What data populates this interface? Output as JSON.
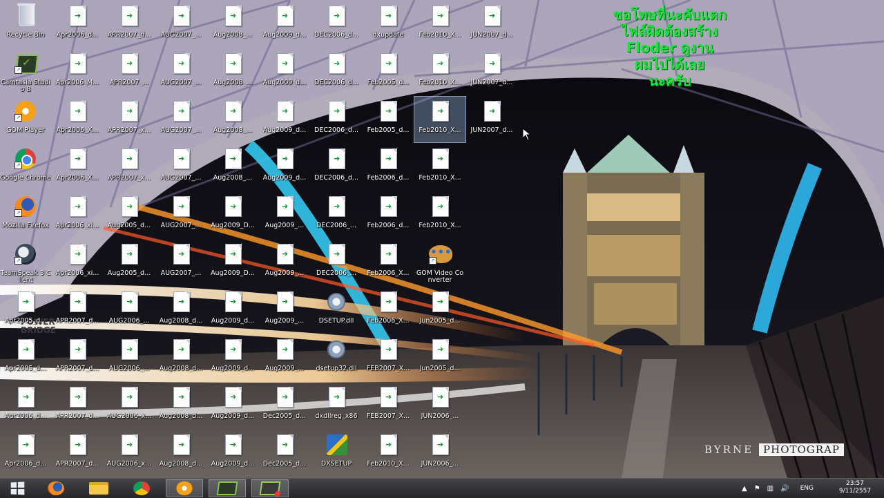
{
  "desktop": {
    "columns": [
      [
        {
          "label": "Recycle Bin",
          "kind": "recycle"
        },
        {
          "label": "Camtasia Studio 8",
          "kind": "camtasia",
          "shortcut": true
        },
        {
          "label": "GOM Player",
          "kind": "gom",
          "shortcut": true
        },
        {
          "label": "Google Chrome",
          "kind": "chrome",
          "shortcut": true
        },
        {
          "label": "Mozilla Firefox",
          "kind": "firefox",
          "shortcut": true
        },
        {
          "label": "TeamSpeak 3 Client",
          "kind": "teamspeak",
          "shortcut": true
        },
        {
          "label": "Apr2005_d...",
          "kind": "doc"
        },
        {
          "label": "Apr2005_d...",
          "kind": "doc"
        },
        {
          "label": "Apr2006_d...",
          "kind": "doc"
        },
        {
          "label": "Apr2006_d...",
          "kind": "doc"
        }
      ],
      [
        {
          "label": "Apr2006_d...",
          "kind": "doc"
        },
        {
          "label": "Apr2006_M...",
          "kind": "doc"
        },
        {
          "label": "Apr2006_X...",
          "kind": "doc"
        },
        {
          "label": "Apr2006_X...",
          "kind": "doc"
        },
        {
          "label": "Apr2006_xi...",
          "kind": "doc"
        },
        {
          "label": "Apr2006_xi...",
          "kind": "doc"
        },
        {
          "label": "APR2007_d...",
          "kind": "doc"
        },
        {
          "label": "APR2007_d...",
          "kind": "doc"
        },
        {
          "label": "APR2007_d...",
          "kind": "doc"
        },
        {
          "label": "APR2007_d...",
          "kind": "doc"
        }
      ],
      [
        {
          "label": "APR2007_d...",
          "kind": "doc"
        },
        {
          "label": "APR2007_...",
          "kind": "doc"
        },
        {
          "label": "APR2007_x...",
          "kind": "doc"
        },
        {
          "label": "APR2007_x...",
          "kind": "doc"
        },
        {
          "label": "Aug2005_d...",
          "kind": "doc"
        },
        {
          "label": "Aug2005_d...",
          "kind": "doc"
        },
        {
          "label": "AUG2006_...",
          "kind": "doc"
        },
        {
          "label": "AUG2006_...",
          "kind": "doc"
        },
        {
          "label": "AUG2006_x...",
          "kind": "doc"
        },
        {
          "label": "AUG2006_x...",
          "kind": "doc"
        }
      ],
      [
        {
          "label": "AUG2007_...",
          "kind": "doc"
        },
        {
          "label": "AUG2007_...",
          "kind": "doc"
        },
        {
          "label": "AUG2007_...",
          "kind": "doc"
        },
        {
          "label": "AUG2007_...",
          "kind": "doc"
        },
        {
          "label": "AUG2007_...",
          "kind": "doc"
        },
        {
          "label": "AUG2007_...",
          "kind": "doc"
        },
        {
          "label": "Aug2008_d...",
          "kind": "doc"
        },
        {
          "label": "Aug2008_d...",
          "kind": "doc"
        },
        {
          "label": "Aug2008_d...",
          "kind": "doc"
        },
        {
          "label": "Aug2008_d...",
          "kind": "doc"
        }
      ],
      [
        {
          "label": "Aug2008_...",
          "kind": "doc"
        },
        {
          "label": "Aug2008_...",
          "kind": "doc"
        },
        {
          "label": "Aug2008_...",
          "kind": "doc"
        },
        {
          "label": "Aug2008_...",
          "kind": "doc"
        },
        {
          "label": "Aug2009_D...",
          "kind": "doc"
        },
        {
          "label": "Aug2009_D...",
          "kind": "doc"
        },
        {
          "label": "Aug2009_d...",
          "kind": "doc"
        },
        {
          "label": "Aug2009_d...",
          "kind": "doc"
        },
        {
          "label": "Aug2009_d...",
          "kind": "doc"
        },
        {
          "label": "Aug2009_d...",
          "kind": "doc"
        }
      ],
      [
        {
          "label": "Aug2009_d...",
          "kind": "doc"
        },
        {
          "label": "Aug2009_d...",
          "kind": "doc"
        },
        {
          "label": "Aug2009_d...",
          "kind": "doc"
        },
        {
          "label": "Aug2009_d...",
          "kind": "doc"
        },
        {
          "label": "Aug2009_...",
          "kind": "doc"
        },
        {
          "label": "Aug2009_...",
          "kind": "doc"
        },
        {
          "label": "Aug2009_...",
          "kind": "doc"
        },
        {
          "label": "Aug2009_...",
          "kind": "doc"
        },
        {
          "label": "Dec2005_d...",
          "kind": "doc"
        },
        {
          "label": "Dec2005_d...",
          "kind": "doc"
        }
      ],
      [
        {
          "label": "DEC2006_d...",
          "kind": "doc"
        },
        {
          "label": "DEC2006_d...",
          "kind": "doc"
        },
        {
          "label": "DEC2006_d...",
          "kind": "doc"
        },
        {
          "label": "DEC2006_d...",
          "kind": "doc"
        },
        {
          "label": "DEC2006_...",
          "kind": "doc"
        },
        {
          "label": "DEC2006_...",
          "kind": "doc"
        },
        {
          "label": "DSETUP.dll",
          "kind": "gear"
        },
        {
          "label": "dsetup32.dll",
          "kind": "gear"
        },
        {
          "label": "dxdllreg_x86",
          "kind": "doc"
        },
        {
          "label": "DXSETUP",
          "kind": "setup"
        }
      ],
      [
        {
          "label": "dxupdate",
          "kind": "doc"
        },
        {
          "label": "Feb2005_d...",
          "kind": "doc"
        },
        {
          "label": "Feb2005_d...",
          "kind": "doc"
        },
        {
          "label": "Feb2006_d...",
          "kind": "doc"
        },
        {
          "label": "Feb2006_d...",
          "kind": "doc"
        },
        {
          "label": "Feb2006_X...",
          "kind": "doc"
        },
        {
          "label": "Feb2006_X...",
          "kind": "doc"
        },
        {
          "label": "FEB2007_X...",
          "kind": "doc"
        },
        {
          "label": "FEB2007_X...",
          "kind": "doc"
        },
        {
          "label": "Feb2010_X...",
          "kind": "doc"
        }
      ],
      [
        {
          "label": "Feb2010_X...",
          "kind": "doc"
        },
        {
          "label": "Feb2010_X...",
          "kind": "doc"
        },
        {
          "label": "Feb2010_X...",
          "kind": "doc",
          "selected": true
        },
        {
          "label": "Feb2010_X...",
          "kind": "doc"
        },
        {
          "label": "Feb2010_X...",
          "kind": "doc"
        },
        {
          "label": "GOM Video Converter",
          "kind": "palette",
          "shortcut": true
        },
        {
          "label": "Jun2005_d...",
          "kind": "doc"
        },
        {
          "label": "Jun2005_d...",
          "kind": "doc"
        },
        {
          "label": "JUN2006_...",
          "kind": "doc"
        },
        {
          "label": "JUN2006_...",
          "kind": "doc"
        }
      ],
      [
        {
          "label": "JUN2007_d...",
          "kind": "doc"
        },
        {
          "label": "JUN2007_d...",
          "kind": "doc"
        },
        {
          "label": "JUN2007_d...",
          "kind": "doc"
        }
      ]
    ]
  },
  "overlay": {
    "lines": [
      "ขอโทษที่นะคับแตก",
      "ไฟล์ผิดต้องสร้าง",
      "Floder ดูงาน",
      "ผมไปได้เลย",
      "นะครับ"
    ],
    "color": "#19e53c"
  },
  "watermark": {
    "left": "BYRNE",
    "right": "PHOTOGRAP"
  },
  "taskbar": {
    "pinned": [
      {
        "name": "firefox",
        "icon": "firefox-icon"
      },
      {
        "name": "file-explorer",
        "icon": "folder-icon"
      },
      {
        "name": "chrome",
        "icon": "chrome-icon"
      },
      {
        "name": "gom-player",
        "icon": "gom-icon",
        "active": true
      },
      {
        "name": "camtasia-recorder",
        "icon": "camtasia-icon"
      },
      {
        "name": "camtasia-studio",
        "icon": "camtasia-record-icon"
      }
    ],
    "tray": {
      "language": "ENG",
      "time": "23:57",
      "date": "9/11/2557"
    }
  }
}
